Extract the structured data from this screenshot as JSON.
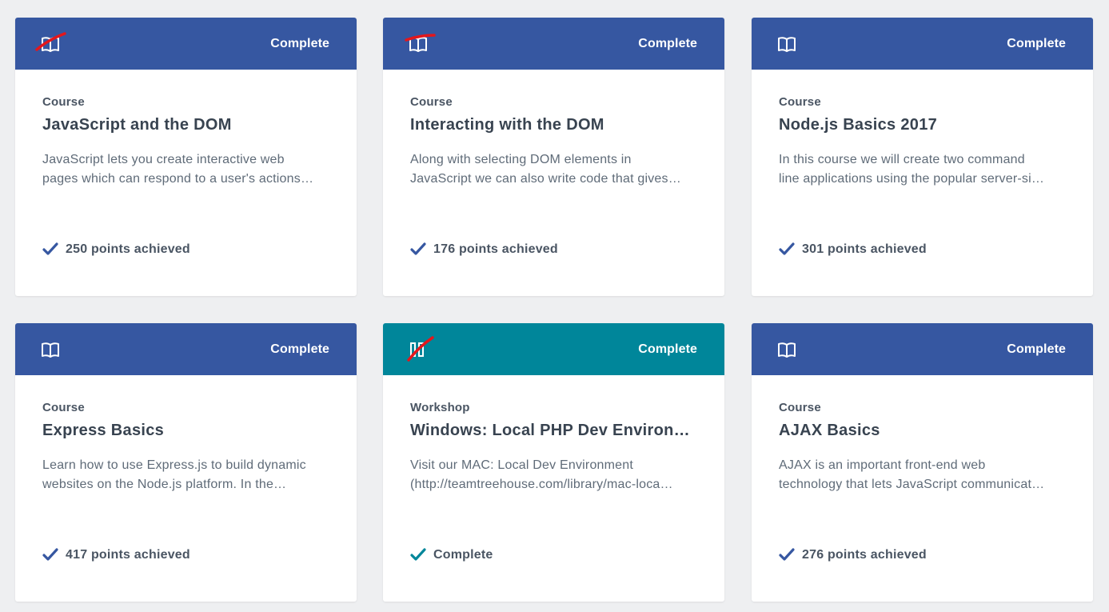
{
  "colors": {
    "header_blue": "#3657a1",
    "header_teal": "#00869a",
    "check_blue": "#3657a1",
    "check_teal": "#00869a",
    "strike_red": "#e3171c",
    "page_bg": "#eeeff1"
  },
  "cards": [
    {
      "header_icon": "book-icon",
      "header_status": "Complete",
      "type": "Course",
      "title": "JavaScript and the DOM",
      "desc_line1": "JavaScript lets you create interactive web",
      "desc_line2": "pages which can respond to a user's actions…",
      "footer": "250 points achieved",
      "theme": "blue"
    },
    {
      "header_icon": "book-icon",
      "header_status": "Complete",
      "type": "Course",
      "title": "Interacting with the DOM",
      "desc_line1": "Along with selecting DOM elements in",
      "desc_line2": "JavaScript we can also write code that gives…",
      "footer": "176 points achieved",
      "theme": "blue"
    },
    {
      "header_icon": "book-icon",
      "header_status": "Complete",
      "type": "Course",
      "title": "Node.js Basics 2017",
      "desc_line1": "In this course we will create two command",
      "desc_line2": "line applications using the popular server-si…",
      "footer": "301 points achieved",
      "theme": "blue"
    },
    {
      "header_icon": "book-icon",
      "header_status": "Complete",
      "type": "Course",
      "title": "Express Basics",
      "desc_line1": "Learn how to use Express.js to build dynamic",
      "desc_line2": "websites on the Node.js platform. In the…",
      "footer": "417 points achieved",
      "theme": "blue"
    },
    {
      "header_icon": "workshop-icon",
      "header_status": "Complete",
      "type": "Workshop",
      "title": "Windows: Local PHP Dev Environ…",
      "desc_line1": "Visit our MAC: Local Dev Environment",
      "desc_line2": "(http://teamtreehouse.com/library/mac-loca…",
      "footer": "Complete",
      "theme": "teal"
    },
    {
      "header_icon": "book-icon",
      "header_status": "Complete",
      "type": "Course",
      "title": "AJAX Basics",
      "desc_line1": "AJAX is an important front-end web",
      "desc_line2": "technology that lets JavaScript communicat…",
      "footer": "276 points achieved",
      "theme": "blue"
    }
  ]
}
